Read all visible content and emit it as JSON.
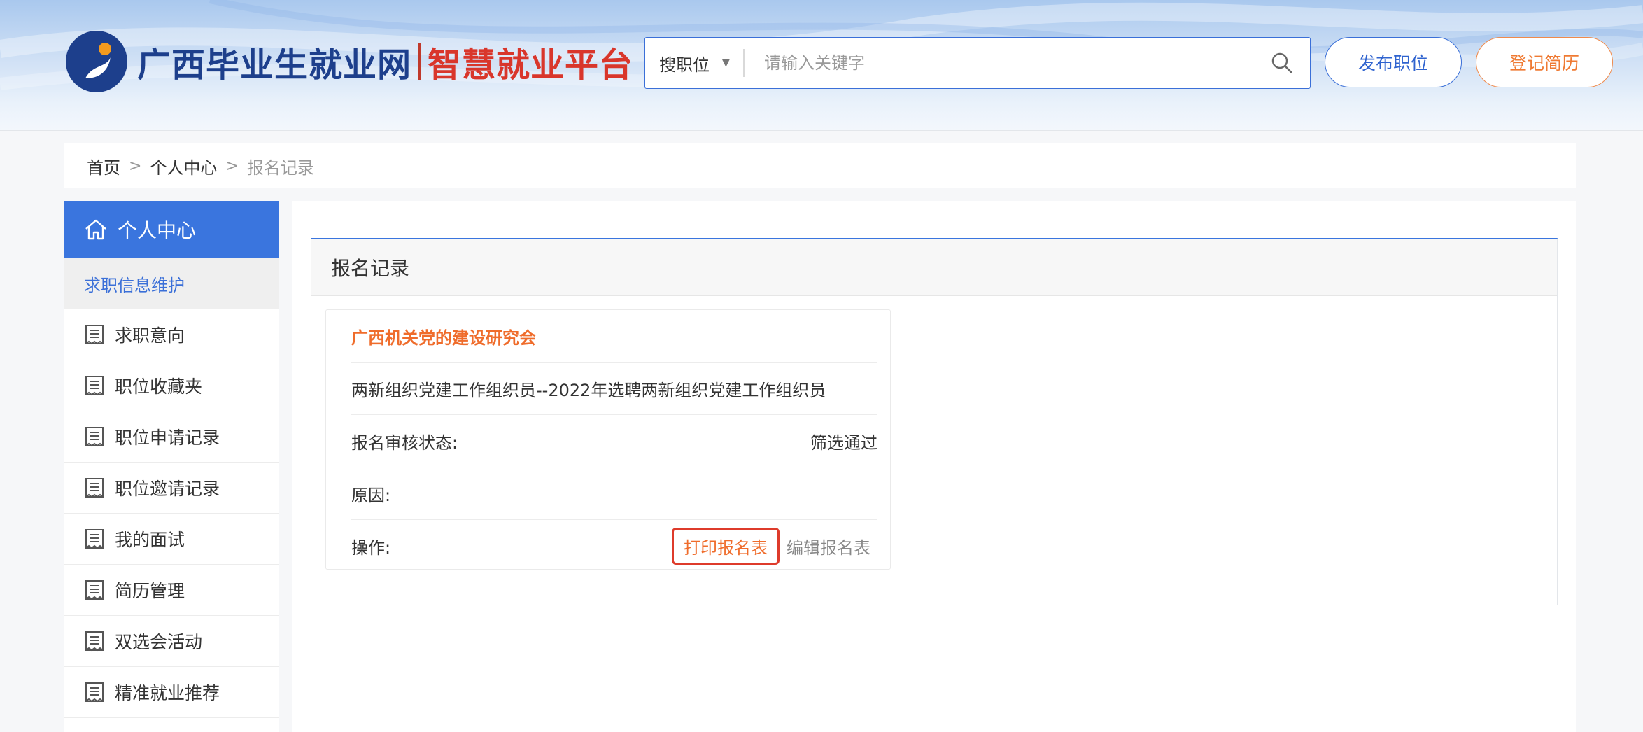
{
  "header": {
    "logo_text_main": "广西毕业生就业网",
    "logo_text_sub": "智慧就业平台",
    "search": {
      "type_label": "搜职位",
      "placeholder": "请输入关键字"
    },
    "post_job_label": "发布职位",
    "register_resume_label": "登记简历"
  },
  "breadcrumb": {
    "items": [
      "首页",
      "个人中心",
      "报名记录"
    ]
  },
  "sidebar": {
    "title": "个人中心",
    "group_label": "求职信息维护",
    "items": [
      {
        "label": "求职意向"
      },
      {
        "label": "职位收藏夹"
      },
      {
        "label": "职位申请记录"
      },
      {
        "label": "职位邀请记录"
      },
      {
        "label": "我的面试"
      },
      {
        "label": "简历管理"
      },
      {
        "label": "双选会活动"
      },
      {
        "label": "精准就业推荐"
      }
    ]
  },
  "main": {
    "panel_title": "报名记录",
    "record": {
      "company": "广西机关党的建设研究会",
      "position": "两新组织党建工作组织员--2022年选聘两新组织党建工作组织员",
      "status_label": "报名审核状态:",
      "status_value": "筛选通过",
      "reason_label": "原因:",
      "reason_value": "",
      "ops_label": "操作:",
      "print_label": "打印报名表",
      "edit_label": "编辑报名表"
    }
  },
  "colors": {
    "primary_blue": "#3a75de",
    "accent_orange": "#ef6c2b",
    "highlight_red": "#de3b2b"
  }
}
